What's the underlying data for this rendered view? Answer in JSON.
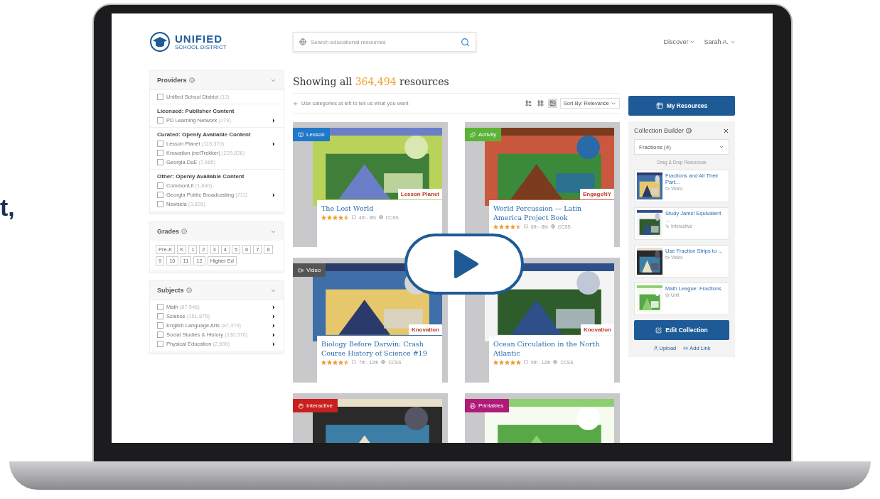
{
  "side_text": "t,",
  "header": {
    "logo_title": "UNIFIED",
    "logo_subtitle": "SCHOOL DISTRICT",
    "search": {
      "placeholder": "Search educational resources"
    },
    "menus": [
      "Discover",
      "Sarah A."
    ]
  },
  "sidebar": {
    "sections": [
      {
        "kind": "filters",
        "title": "Providers",
        "groups": [
          {
            "items": [
              {
                "label": "Unified School District",
                "count": "(13)",
                "checked": false,
                "expandable": false
              }
            ]
          },
          {
            "title": "Licensed: Publisher Content",
            "items": [
              {
                "label": "PD Learning Network",
                "count": "(179)",
                "checked": false,
                "expandable": true
              }
            ]
          },
          {
            "title": "Curated: Openly Available Content",
            "items": [
              {
                "label": "Lesson Planet",
                "count": "(115,370)",
                "checked": false,
                "expandable": true
              },
              {
                "label": "Knovation (netTrekker)",
                "count": "(229,826)",
                "checked": false,
                "expandable": false
              },
              {
                "label": "Georgia DoE",
                "count": "(7,665)",
                "checked": false,
                "expandable": false
              }
            ]
          },
          {
            "title": "Other: Openly Available Content",
            "items": [
              {
                "label": "CommonLit",
                "count": "(1,840)",
                "checked": false,
                "expandable": false
              },
              {
                "label": "Georgia Public Broadcasting",
                "count": "(711)",
                "checked": false,
                "expandable": true
              },
              {
                "label": "Newsela",
                "count": "(3,826)",
                "checked": false,
                "expandable": false
              }
            ]
          }
        ]
      },
      {
        "kind": "grades",
        "title": "Grades",
        "grades": [
          {
            "label": "Pre-K",
            "selected": false
          },
          {
            "label": "K",
            "selected": false
          },
          {
            "label": "1",
            "selected": false
          },
          {
            "label": "2",
            "selected": false
          },
          {
            "label": "3",
            "selected": false
          },
          {
            "label": "4",
            "selected": false
          },
          {
            "label": "5",
            "selected": false
          },
          {
            "label": "6",
            "selected": false
          },
          {
            "label": "7",
            "selected": false
          },
          {
            "label": "8",
            "selected": false
          },
          {
            "label": "9",
            "selected": false
          },
          {
            "label": "10",
            "selected": false
          },
          {
            "label": "11",
            "selected": false
          },
          {
            "label": "12",
            "selected": false
          },
          {
            "label": "Higher Ed",
            "selected": false
          }
        ]
      },
      {
        "kind": "filters",
        "title": "Subjects",
        "groups": [
          {
            "items": [
              {
                "label": "Math",
                "count": "(87,546)",
                "checked": false,
                "expandable": true
              },
              {
                "label": "Science",
                "count": "(151,875)",
                "checked": false,
                "expandable": true
              },
              {
                "label": "English Language Arts",
                "count": "(87,379)",
                "checked": false,
                "expandable": true
              },
              {
                "label": "Social Studies & History",
                "count": "(130,370)",
                "checked": false,
                "expandable": true
              },
              {
                "label": "Physical Education",
                "count": "(2,598)",
                "checked": false,
                "expandable": true
              }
            ]
          }
        ]
      }
    ]
  },
  "results": {
    "heading": "Showing all **364,494** resources",
    "hint": "Use categories at left to tell us what you want",
    "views": [
      {
        "selected": false
      },
      {
        "selected": false
      },
      {
        "selected": true
      }
    ],
    "sort": "Sort By: Relevance",
    "cards": [
      {
        "kind": "lesson",
        "badge": "Lesson",
        "color": "#1f78c8",
        "provider": "Lesson Planet",
        "title": "The Lost World",
        "stars": 4.5,
        "grades": "4th - 8th",
        "standard": "CCSS"
      },
      {
        "kind": "activity",
        "badge": "Activity",
        "color": "#5bb336",
        "provider": "EngageNY",
        "title": "World Percussion — Latin America Project Book",
        "stars": 4.5,
        "grades": "6th - 8th",
        "standard": "CCSS"
      },
      {
        "kind": "video",
        "badge": "Video",
        "color": "#555555",
        "provider": "Knovation",
        "title": "Biology Before Darwin: Crash Course History of Science #19",
        "stars": 4.5,
        "grades": "7th - 12th",
        "standard": "CCSS"
      },
      {
        "kind": "website",
        "provider": "Knovation",
        "title": "Ocean Circulation in the North Atlantic",
        "stars": 5,
        "grades": "9th - 12th",
        "standard": "CCSS"
      },
      {
        "kind": "interactive",
        "badge": "Interactive",
        "color": "#c8201f"
      },
      {
        "kind": "printable",
        "badge": "Printables",
        "color": "#b01a78"
      }
    ]
  },
  "collection": {
    "my_resources": "My Resources",
    "title": "Collection Builder",
    "select": "Fractions (4)",
    "hint": "Drag & Drop Resources",
    "items": [
      {
        "title": "Fractions and All Their Part...",
        "kind": "video",
        "type_label": "Video"
      },
      {
        "title": "Study Jams! Equivalent ...",
        "kind": "interactive",
        "type_label": "Interactive"
      },
      {
        "title": "Use Fraction Strips to ...",
        "kind": "video",
        "type_label": "Video"
      },
      {
        "title": "Math League: Fractions",
        "kind": "unit",
        "type_label": "Unit"
      }
    ],
    "edit": "Edit Collection",
    "actions": [
      {
        "kind": "upload",
        "label": "Upload"
      },
      {
        "kind": "link",
        "label": "Add Link"
      }
    ]
  }
}
